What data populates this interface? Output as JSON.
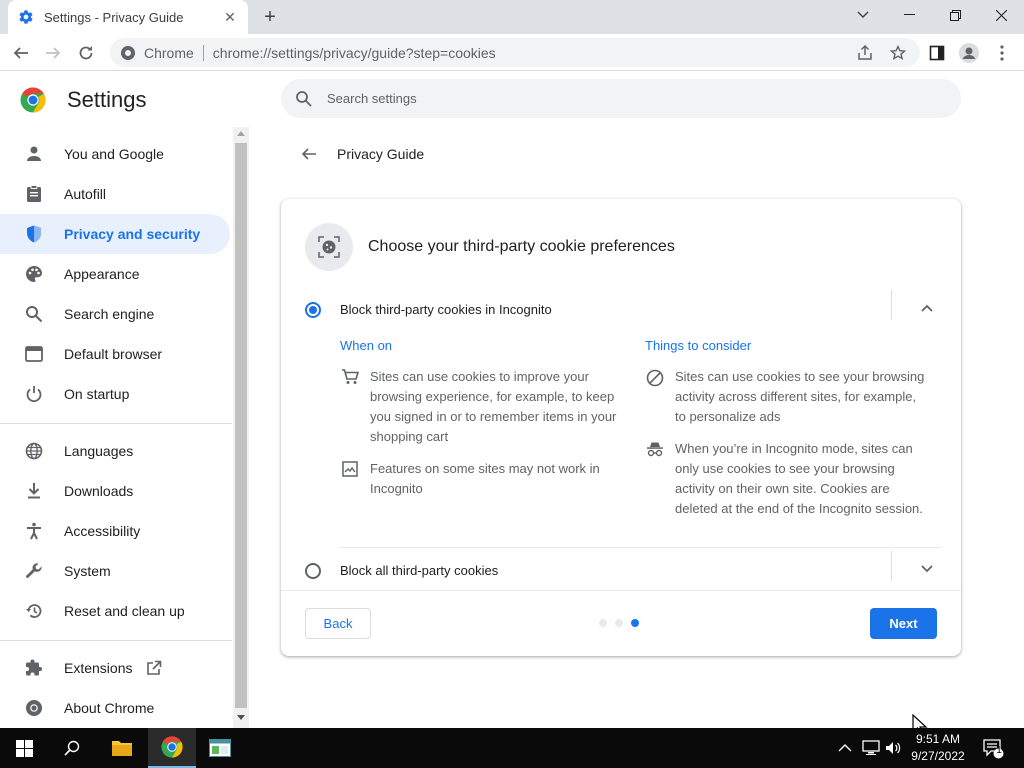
{
  "browser": {
    "tab_title": "Settings - Privacy Guide",
    "omnibox_site": "Chrome",
    "omnibox_url": "chrome://settings/privacy/guide?step=cookies"
  },
  "settings": {
    "title": "Settings",
    "search_placeholder": "Search settings"
  },
  "sidebar": {
    "items": [
      {
        "label": "You and Google",
        "icon": "person-icon"
      },
      {
        "label": "Autofill",
        "icon": "clipboard-icon"
      },
      {
        "label": "Privacy and security",
        "icon": "shield-icon",
        "active": true
      },
      {
        "label": "Appearance",
        "icon": "palette-icon"
      },
      {
        "label": "Search engine",
        "icon": "search-icon"
      },
      {
        "label": "Default browser",
        "icon": "browser-window-icon"
      },
      {
        "label": "On startup",
        "icon": "power-icon"
      },
      {
        "label": "Languages",
        "icon": "globe-icon"
      },
      {
        "label": "Downloads",
        "icon": "download-icon"
      },
      {
        "label": "Accessibility",
        "icon": "accessibility-icon"
      },
      {
        "label": "System",
        "icon": "wrench-icon"
      },
      {
        "label": "Reset and clean up",
        "icon": "history-icon"
      },
      {
        "label": "Extensions",
        "icon": "puzzle-icon"
      },
      {
        "label": "About Chrome",
        "icon": "chrome-icon"
      }
    ]
  },
  "guide": {
    "title": "Privacy Guide",
    "card_title": "Choose your third-party cookie preferences",
    "option1_label": "Block third-party cookies in Incognito",
    "option2_label": "Block all third-party cookies",
    "when_on_heading": "When on",
    "consider_heading": "Things to consider",
    "when_on": [
      "Sites can use cookies to improve your browsing experience, for example, to keep you signed in or to remember items in your shopping cart",
      "Features on some sites may not work in Incognito"
    ],
    "consider": [
      "Sites can use cookies to see your browsing activity across different sites, for example, to personalize ads",
      "When you’re in Incognito mode, sites can only use cookies to see your browsing activity on their own site. Cookies are deleted at the end of the Incognito session."
    ],
    "back_label": "Back",
    "next_label": "Next",
    "step_current": 3,
    "step_total": 3
  },
  "taskbar": {
    "time": "9:51 AM",
    "date": "9/27/2022",
    "notification_count": "1"
  },
  "colors": {
    "accent": "#1a73e8",
    "active_nav_bg": "#e8f0fe"
  }
}
